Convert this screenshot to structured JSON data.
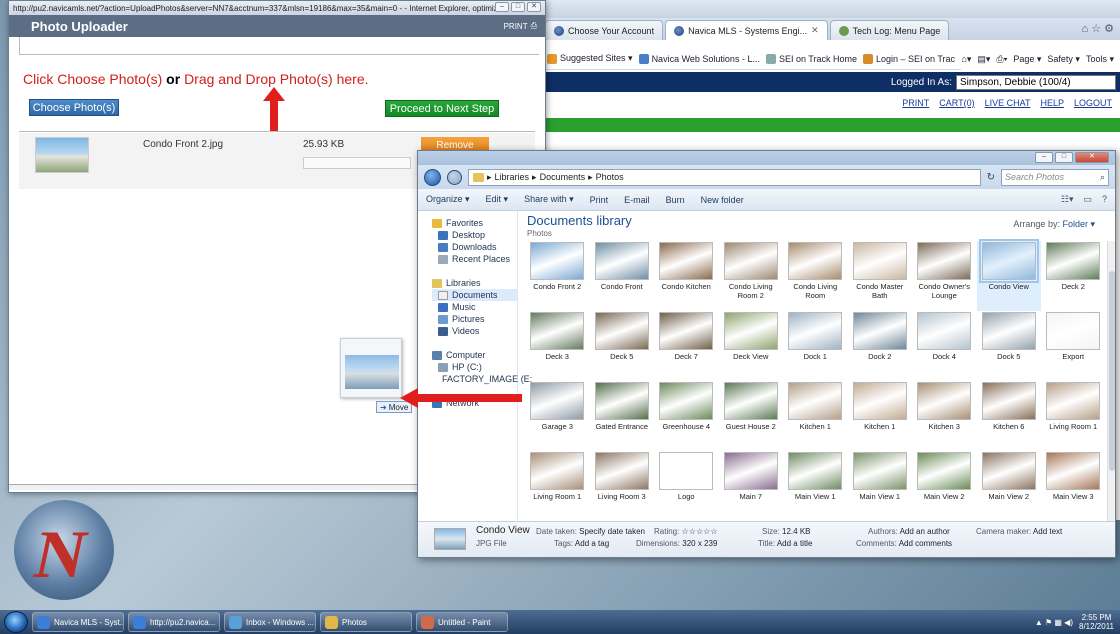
{
  "ie": {
    "tabs": [
      {
        "label": "Choose Your Account",
        "active": false
      },
      {
        "label": "Navica MLS - Systems Engi...",
        "active": true
      },
      {
        "label": "Tech Log: Menu Page",
        "active": false
      }
    ],
    "favorites": [
      "Suggested Sites ▾",
      "Navica Web Solutions - L...",
      "SEI on Track Home",
      "Login – SEI on Trac"
    ],
    "command_bar": [
      "Page ▾",
      "Safety ▾",
      "Tools ▾"
    ],
    "logged_in_label": "Logged In As:",
    "logged_in_value": "Simpson, Debbie (100/4)",
    "links": [
      "PRINT",
      "CART(0)",
      "LIVE CHAT",
      "HELP",
      "LOGOUT"
    ]
  },
  "uploader": {
    "window_title": "http://pu2.navicamls.net/?action=UploadPhotos&server=NN7&acctnum=337&mlsn=19186&max=35&main=0 - - Internet Explorer, optimized",
    "header_title": "Photo Uploader",
    "print_label": "PRINT",
    "instruction_1": "Click Choose Photo(s)",
    "instruction_or": "or",
    "instruction_2": "Drag and Drop Photo(s) here.",
    "choose_button": "Choose Photo(s)",
    "proceed_button": "Proceed to Next Step",
    "file": {
      "name": "Condo Front 2.jpg",
      "size": "25.93 KB",
      "remove_label": "Remove"
    }
  },
  "drag": {
    "tooltip": "Move"
  },
  "explorer": {
    "breadcrumb": [
      "Libraries",
      "Documents",
      "Photos"
    ],
    "search_placeholder": "Search Photos",
    "toolbar": [
      "Organize ▾",
      "Edit ▾",
      "Share with ▾",
      "Print",
      "E-mail",
      "Burn",
      "New folder"
    ],
    "library_title": "Documents library",
    "library_sub": "Photos",
    "arrange_label": "Arrange by:",
    "arrange_value": "Folder ▾",
    "nav": {
      "favorites": [
        "Favorites",
        "Desktop",
        "Downloads",
        "Recent Places"
      ],
      "libraries": [
        "Libraries",
        "Documents",
        "Music",
        "Pictures",
        "Videos"
      ],
      "computer": [
        "Computer",
        "HP (C:)",
        "FACTORY_IMAGE (E:"
      ],
      "network": [
        "Network"
      ]
    },
    "photos": [
      {
        "label": "Condo Front 2",
        "color": "#7aa9d3"
      },
      {
        "label": "Condo Front",
        "color": "#6f8fa6"
      },
      {
        "label": "Condo Kitchen",
        "color": "#8a6a4c"
      },
      {
        "label": "Condo Living Room 2",
        "color": "#9e8872"
      },
      {
        "label": "Condo Living Room",
        "color": "#a88b6c"
      },
      {
        "label": "Condo Master Bath",
        "color": "#c9b8a0"
      },
      {
        "label": "Condo Owner's Lounge",
        "color": "#7d6c5a"
      },
      {
        "label": "Condo View",
        "color": "#8fb8dc",
        "selected": true
      },
      {
        "label": "Deck 2",
        "color": "#5f7d58"
      },
      {
        "label": "Deck 3",
        "color": "#647a5e"
      },
      {
        "label": "Deck 5",
        "color": "#7a6a54"
      },
      {
        "label": "Deck 7",
        "color": "#6f6048"
      },
      {
        "label": "Deck View",
        "color": "#8ea46e"
      },
      {
        "label": "Dock 1",
        "color": "#9fb3c4"
      },
      {
        "label": "Dock 2",
        "color": "#6e8899"
      },
      {
        "label": "Dock 4",
        "color": "#b3c4cf"
      },
      {
        "label": "Dock 5",
        "color": "#93a3ad"
      },
      {
        "label": "Export",
        "color": "#f4f4f4"
      },
      {
        "label": "Garage 3",
        "color": "#8f9aa6"
      },
      {
        "label": "Gated Entrance",
        "color": "#56704c"
      },
      {
        "label": "Greenhouse 4",
        "color": "#6c8b5c"
      },
      {
        "label": "Guest House 2",
        "color": "#5b7b55"
      },
      {
        "label": "Kitchen 1",
        "color": "#b5a08a"
      },
      {
        "label": "Kitchen 1",
        "color": "#c2ab92"
      },
      {
        "label": "Kitchen 3",
        "color": "#a88f74"
      },
      {
        "label": "Kitchen 6",
        "color": "#8a6f58"
      },
      {
        "label": "Living Room 1",
        "color": "#b9a088"
      },
      {
        "label": "Living Room 1",
        "color": "#a99078"
      },
      {
        "label": "Living Room 3",
        "color": "#8e7764"
      },
      {
        "label": "Logo",
        "color": "#ffffff"
      },
      {
        "label": "Main 7",
        "color": "#8a6d8f"
      },
      {
        "label": "Main View 1",
        "color": "#6f8c63"
      },
      {
        "label": "Main View 1",
        "color": "#7c936a"
      },
      {
        "label": "Main View 2",
        "color": "#6a8c56"
      },
      {
        "label": "Main View 2",
        "color": "#8a7461"
      },
      {
        "label": "Main View 3",
        "color": "#a87757"
      }
    ],
    "status": {
      "name": "Condo View",
      "type": "JPG File",
      "date_label": "Date taken:",
      "date_value": "Specify date taken",
      "tags_label": "Tags:",
      "tags_value": "Add a tag",
      "rating_label": "Rating:",
      "rating_value": "☆☆☆☆☆",
      "dimensions_label": "Dimensions:",
      "dimensions_value": "320 x 239",
      "size_label": "Size:",
      "size_value": "12.4 KB",
      "title_label": "Title:",
      "title_value": "Add a title",
      "authors_label": "Authors:",
      "authors_value": "Add an author",
      "comments_label": "Comments:",
      "comments_value": "Add comments",
      "camera_label": "Camera maker:",
      "camera_value": "Add text"
    }
  },
  "taskbar": {
    "items": [
      {
        "label": "Navica MLS - Syst...",
        "color": "#3b7dd8"
      },
      {
        "label": "http://pu2.navica...",
        "color": "#3b7dd8"
      },
      {
        "label": "Inbox - Windows ...",
        "color": "#5aa0d8"
      },
      {
        "label": "Photos",
        "color": "#e0b84a"
      },
      {
        "label": "Untitled - Paint",
        "color": "#d06a4a"
      }
    ],
    "time": "2:55 PM",
    "date": "8/12/2011"
  }
}
